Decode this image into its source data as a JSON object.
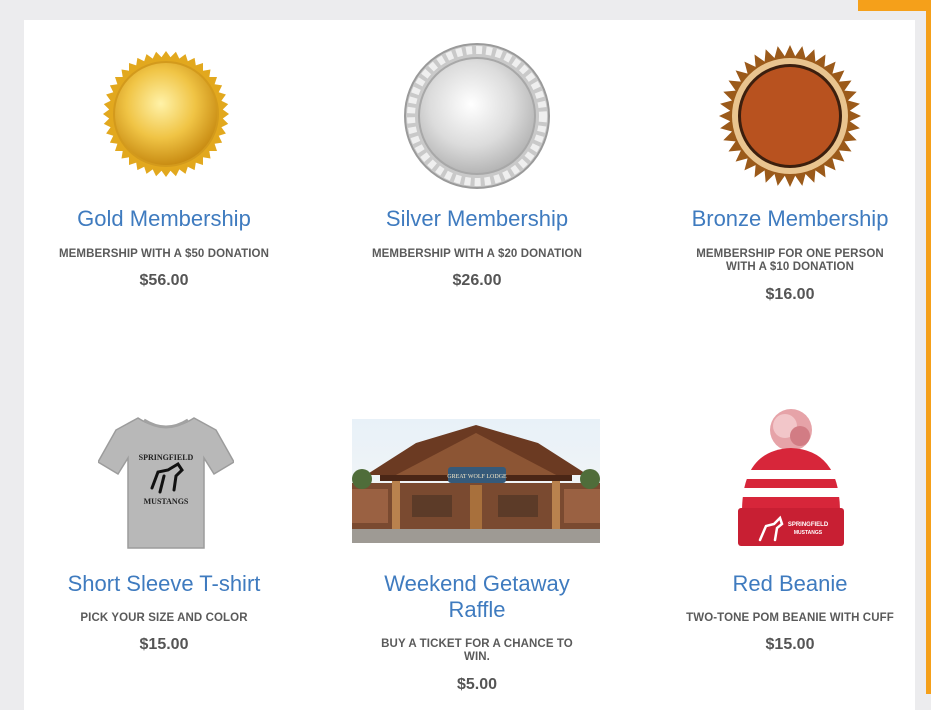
{
  "colors": {
    "accent": "#f5a01a",
    "title": "#3f7bbf",
    "text": "#5a5a5a"
  },
  "products": [
    {
      "title": "Gold Membership",
      "description": "MEMBERSHIP WITH A $50 DONATION",
      "price": "$56.00",
      "image": "gold-medal-icon"
    },
    {
      "title": "Silver Membership",
      "description": "MEMBERSHIP WITH A $20 DONATION",
      "price": "$26.00",
      "image": "silver-medal-icon"
    },
    {
      "title": "Bronze Membership",
      "description_line1": "MEMBERSHIP FOR ONE PERSON",
      "description_line2": "WITH A $10 DONATION",
      "price": "$16.00",
      "image": "bronze-medal-icon"
    },
    {
      "title": "Short Sleeve T-shirt",
      "description": "PICK YOUR SIZE AND COLOR",
      "price": "$15.00",
      "image": "tshirt-image",
      "print_top": "SPRINGFIELD",
      "print_bottom": "MUSTANGS"
    },
    {
      "title_line1": "Weekend Getaway",
      "title_line2": "Raffle",
      "description_line1": "BUY A TICKET FOR A CHANCE TO",
      "description_line2": "WIN.",
      "price": "$5.00",
      "image": "lodge-photo",
      "sign": "GREAT WOLF LODGE"
    },
    {
      "title": "Red Beanie",
      "description": "TWO-TONE POM BEANIE WITH CUFF",
      "price": "$15.00",
      "image": "beanie-image",
      "print_top": "SPRINGFIELD",
      "print_bottom": "MUSTANGS"
    }
  ]
}
